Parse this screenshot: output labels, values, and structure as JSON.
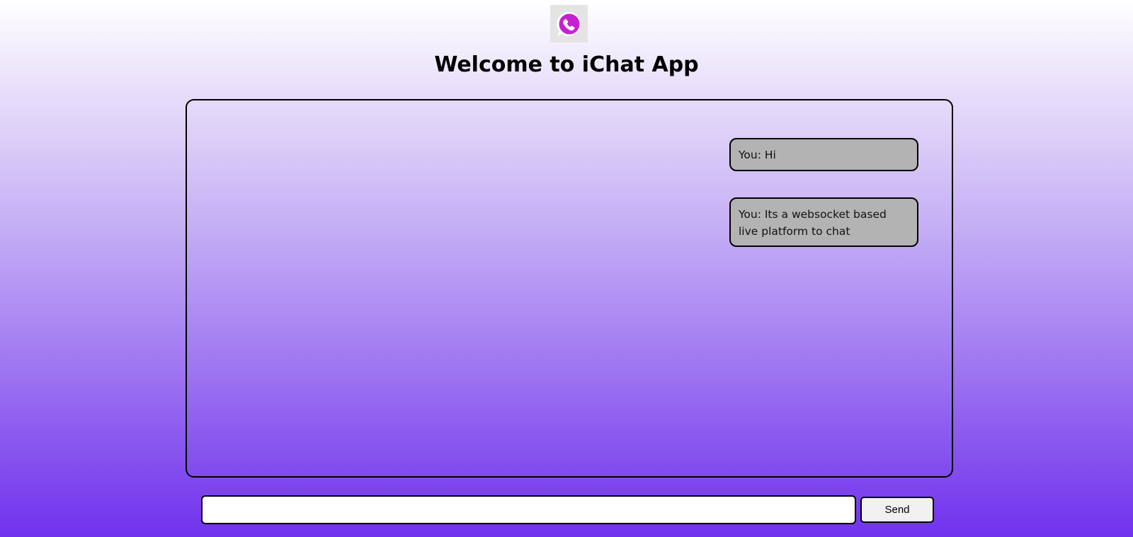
{
  "header": {
    "logo_icon": "whatsapp-logo-icon",
    "logo_color": "#c81fd3",
    "title": "Welcome to iChat App"
  },
  "chat": {
    "messages": [
      {
        "text": "You: Hi",
        "sender": "You"
      },
      {
        "text": "You: Its a websocket based live platform to chat",
        "sender": "You"
      }
    ]
  },
  "composer": {
    "input_value": "",
    "placeholder": "",
    "send_label": "Send"
  },
  "colors": {
    "background_top": "#ffffff",
    "background_bottom": "#7132ed",
    "message_bubble": "#b3b3b3"
  }
}
